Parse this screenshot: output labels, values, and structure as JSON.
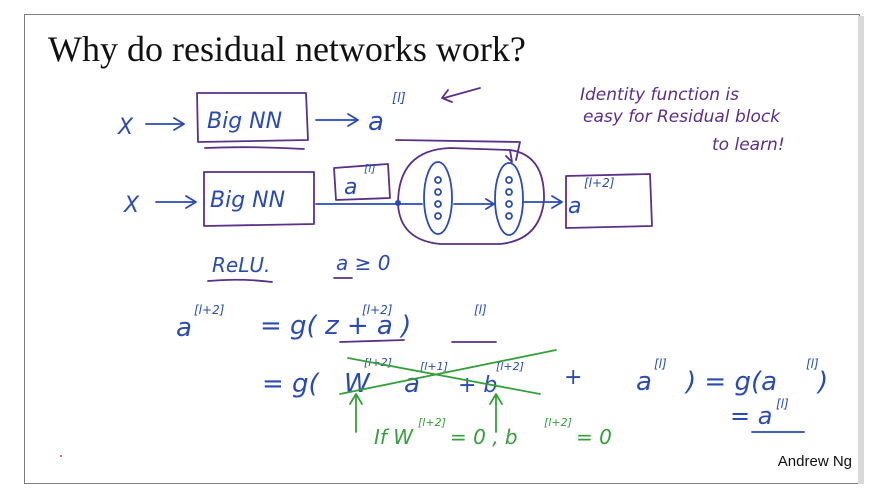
{
  "slide": {
    "title": "Why do residual networks work?",
    "author": "Andrew Ng"
  },
  "handwriting": {
    "x1": "X",
    "x2": "X",
    "big_nn_1": "Big NN",
    "big_nn_2": "Big NN",
    "a_l_1": "a",
    "a_l_1_sup": "[l]",
    "a_l_2": "a",
    "a_l_2_sup": "[l]",
    "a_l2_out": "a",
    "a_l2_out_sup": "[l+2]",
    "note_line1": "Identity function is",
    "note_line2": "easy for Residual block",
    "note_line3": "to learn!",
    "relu": "ReLU.",
    "a_ge0": "a ≥ 0",
    "eq1_lhs": "a",
    "eq1_lhs_sup": "[l+2]",
    "eq1_rhs": "= g( z    + a    )",
    "eq1_z_sup": "[l+2]",
    "eq1_a_sup": "[l]",
    "eq2_start": "= g(",
    "eq2_w": "W",
    "eq2_w_sup": "[l+2]",
    "eq2_a": "a",
    "eq2_a_sup": "[l+1]",
    "eq2_b": "+ b",
    "eq2_b_sup": "[l+2]",
    "eq2_plus": "+",
    "eq2_al": "a",
    "eq2_al_sup": "[l]",
    "eq2_close": ") = g(a",
    "eq2_close_sup": "[l]",
    "eq2_paren": ")",
    "eq3": "= a",
    "eq3_sup": "[l]",
    "if_note": "If W",
    "if_note_sup1": "[l+2]",
    "if_note_mid": "= 0 ,  b",
    "if_note_sup2": "[l+2]",
    "if_note_end": "= 0"
  }
}
